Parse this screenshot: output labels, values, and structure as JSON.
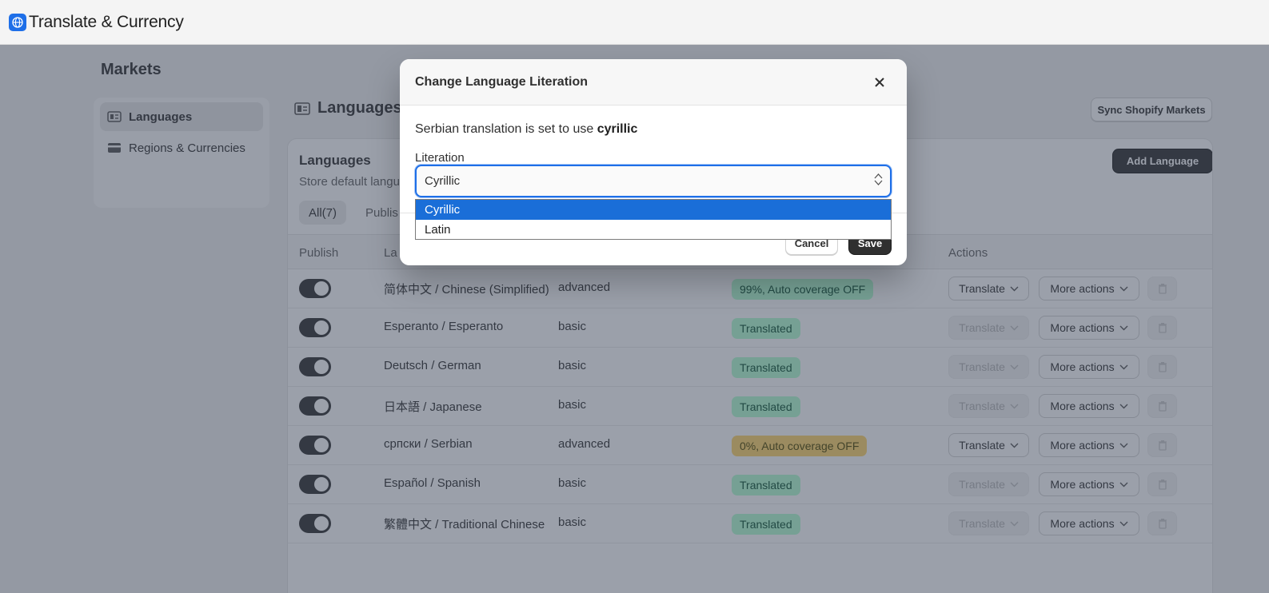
{
  "app": {
    "title": "Translate & Currency",
    "logo_icon": "globe-icon"
  },
  "page": {
    "heading": "Markets"
  },
  "sidebar": {
    "items": [
      {
        "label": "Languages",
        "icon": "language-card-icon",
        "active": true
      },
      {
        "label": "Regions & Currencies",
        "icon": "credit-card-icon",
        "active": false
      }
    ]
  },
  "section": {
    "heading": "Languages",
    "sync_label": "Sync Shopify Markets"
  },
  "card": {
    "title": "Languages",
    "subtitle": "Store default langu",
    "add_label": "Add Language",
    "tabs": [
      "All(7)",
      "Publis"
    ]
  },
  "table": {
    "headers": {
      "publish": "Publish",
      "language": "La",
      "actions": "Actions"
    },
    "rows": [
      {
        "language": "简体中文 / Chinese (Simplified)",
        "plan": "advanced",
        "status": "99%, Auto coverage OFF",
        "status_color": "green",
        "translate": "Translate",
        "translate_enabled": true,
        "more": "More actions"
      },
      {
        "language": "Esperanto / Esperanto",
        "plan": "basic",
        "status": "Translated",
        "status_color": "green",
        "translate": "Translate",
        "translate_enabled": false,
        "more": "More actions"
      },
      {
        "language": "Deutsch / German",
        "plan": "basic",
        "status": "Translated",
        "status_color": "green",
        "translate": "Translate",
        "translate_enabled": false,
        "more": "More actions"
      },
      {
        "language": "日本語 / Japanese",
        "plan": "basic",
        "status": "Translated",
        "status_color": "green",
        "translate": "Translate",
        "translate_enabled": false,
        "more": "More actions"
      },
      {
        "language": "српски / Serbian",
        "plan": "advanced",
        "status": "0%, Auto coverage OFF",
        "status_color": "yellow",
        "translate": "Translate",
        "translate_enabled": true,
        "more": "More actions"
      },
      {
        "language": "Español / Spanish",
        "plan": "basic",
        "status": "Translated",
        "status_color": "green",
        "translate": "Translate",
        "translate_enabled": false,
        "more": "More actions"
      },
      {
        "language": "繁體中文 / Traditional Chinese",
        "plan": "basic",
        "status": "Translated",
        "status_color": "green",
        "translate": "Translate",
        "translate_enabled": false,
        "more": "More actions"
      }
    ]
  },
  "modal": {
    "title": "Change Language Literation",
    "text_prefix": "Serbian translation is set to use ",
    "text_value": "cyrillic",
    "field_label": "Literation",
    "selected": "Cyrillic",
    "options": [
      "Cyrillic",
      "Latin"
    ],
    "cancel_label": "Cancel",
    "save_label": "Save"
  },
  "colors": {
    "accent": "#1e6fe8",
    "dark_button": "#303030",
    "badge_green": "#b4fed2",
    "badge_yellow": "#ffd46a"
  }
}
